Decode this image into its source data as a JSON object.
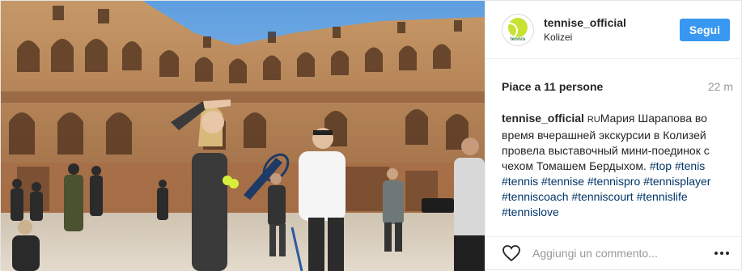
{
  "post": {
    "header": {
      "username": "tennise_official",
      "location": "Kolizei",
      "follow_label": "Segui",
      "avatar_text": "tennis"
    },
    "likes_text": "Piace a 11 persone",
    "time_ago": "22 m",
    "caption": {
      "username": "tennise_official",
      "lang": "RU",
      "text": "Мария Шарапова во время вчерашней экскурсии в Колизей провела выставочный мини-поединок с чехом Томашем Бердыхом.",
      "hashtags": [
        "#top",
        "#tenis",
        "#tennis",
        "#tennise",
        "#tennispro",
        "#tennisplayer",
        "#tenniscoach",
        "#tenniscourt",
        "#tennislife",
        "#tennislove"
      ]
    },
    "comment_placeholder": "Aggiungi un commento...",
    "icons": {
      "like": "heart-icon",
      "more": "more-options-icon",
      "avatar": "tennis-ball-logo"
    },
    "colors": {
      "follow_button": "#3897f0",
      "hashtag": "#003569",
      "muted": "#999999"
    }
  }
}
